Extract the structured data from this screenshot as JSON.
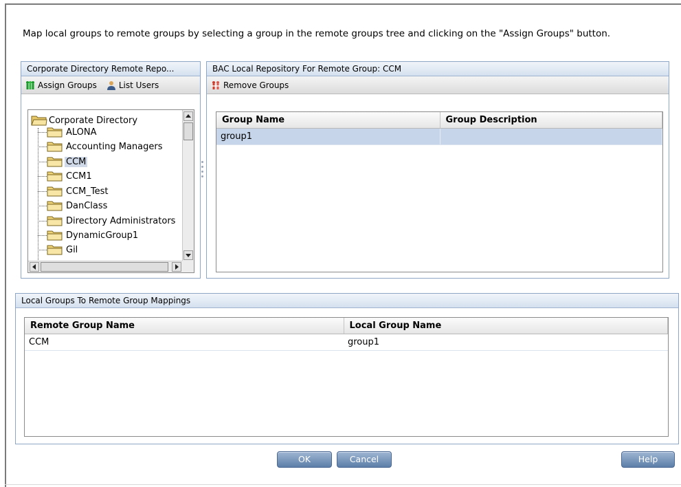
{
  "instructions": "Map local groups to remote groups by selecting a group in the remote groups tree and clicking on the \"Assign Groups\" button.",
  "left_panel": {
    "title": "Corporate Directory Remote Repo...",
    "toolbar": {
      "assign_label": "Assign Groups",
      "list_users_label": "List Users"
    },
    "tree": {
      "root": "Corporate Directory",
      "nodes": [
        "ALONA",
        "Accounting Managers",
        "CCM",
        "CCM1",
        "CCM_Test",
        "DanClass",
        "Directory Administrators",
        "DynamicGroup1",
        "Gil"
      ],
      "selected": "CCM"
    }
  },
  "right_panel": {
    "title": "BAC Local Repository For Remote Group: CCM",
    "toolbar": {
      "remove_label": "Remove Groups"
    },
    "columns": [
      "Group Name",
      "Group Description"
    ],
    "rows": [
      [
        "group1",
        ""
      ]
    ]
  },
  "bottom_panel": {
    "title": "Local Groups To Remote Group Mappings",
    "columns": [
      "Remote Group Name",
      "Local Group Name"
    ],
    "rows": [
      [
        "CCM",
        "group1"
      ]
    ]
  },
  "buttons": {
    "ok": "OK",
    "cancel": "Cancel",
    "help": "Help"
  },
  "colors": {
    "accent": "#5c7ea8",
    "panel_border": "#8ea6c6",
    "selection": "#c6d5ea"
  },
  "icons": {
    "assign": "assign-groups-icon",
    "list_users": "user-icon",
    "remove": "remove-groups-icon",
    "folder": "folder-icon"
  }
}
